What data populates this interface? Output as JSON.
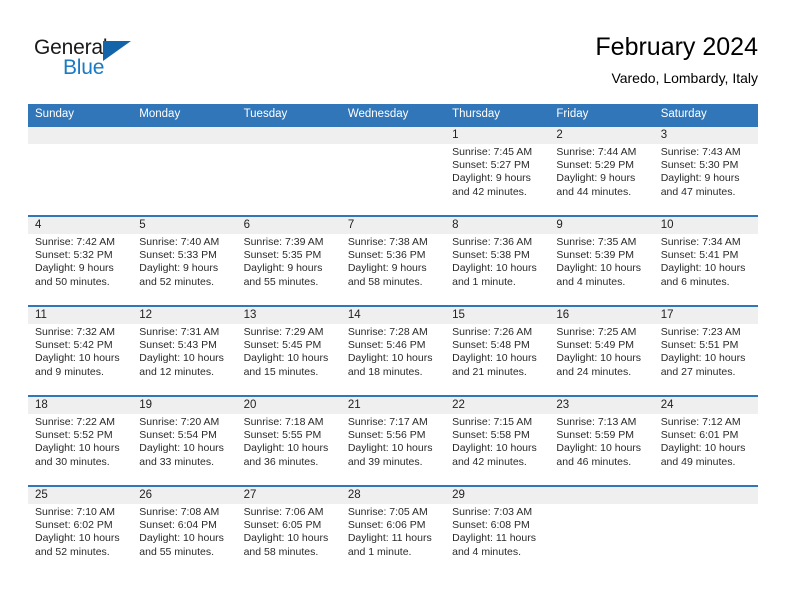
{
  "brand": {
    "name_part1": "General",
    "name_part2": "Blue",
    "accent_color": "#1a7ac4",
    "triangle_color": "#1464aa"
  },
  "header": {
    "title": "February 2024",
    "subtitle": "Varedo, Lombardy, Italy"
  },
  "calendar": {
    "header_bg": "#3176b8",
    "daynum_bg": "#efefef",
    "weekdays": [
      "Sunday",
      "Monday",
      "Tuesday",
      "Wednesday",
      "Thursday",
      "Friday",
      "Saturday"
    ],
    "weeks": [
      [
        {
          "day": "",
          "sunrise": "",
          "sunset": "",
          "daylight": ""
        },
        {
          "day": "",
          "sunrise": "",
          "sunset": "",
          "daylight": ""
        },
        {
          "day": "",
          "sunrise": "",
          "sunset": "",
          "daylight": ""
        },
        {
          "day": "",
          "sunrise": "",
          "sunset": "",
          "daylight": ""
        },
        {
          "day": "1",
          "sunrise": "Sunrise: 7:45 AM",
          "sunset": "Sunset: 5:27 PM",
          "daylight": "Daylight: 9 hours and 42 minutes."
        },
        {
          "day": "2",
          "sunrise": "Sunrise: 7:44 AM",
          "sunset": "Sunset: 5:29 PM",
          "daylight": "Daylight: 9 hours and 44 minutes."
        },
        {
          "day": "3",
          "sunrise": "Sunrise: 7:43 AM",
          "sunset": "Sunset: 5:30 PM",
          "daylight": "Daylight: 9 hours and 47 minutes."
        }
      ],
      [
        {
          "day": "4",
          "sunrise": "Sunrise: 7:42 AM",
          "sunset": "Sunset: 5:32 PM",
          "daylight": "Daylight: 9 hours and 50 minutes."
        },
        {
          "day": "5",
          "sunrise": "Sunrise: 7:40 AM",
          "sunset": "Sunset: 5:33 PM",
          "daylight": "Daylight: 9 hours and 52 minutes."
        },
        {
          "day": "6",
          "sunrise": "Sunrise: 7:39 AM",
          "sunset": "Sunset: 5:35 PM",
          "daylight": "Daylight: 9 hours and 55 minutes."
        },
        {
          "day": "7",
          "sunrise": "Sunrise: 7:38 AM",
          "sunset": "Sunset: 5:36 PM",
          "daylight": "Daylight: 9 hours and 58 minutes."
        },
        {
          "day": "8",
          "sunrise": "Sunrise: 7:36 AM",
          "sunset": "Sunset: 5:38 PM",
          "daylight": "Daylight: 10 hours and 1 minute."
        },
        {
          "day": "9",
          "sunrise": "Sunrise: 7:35 AM",
          "sunset": "Sunset: 5:39 PM",
          "daylight": "Daylight: 10 hours and 4 minutes."
        },
        {
          "day": "10",
          "sunrise": "Sunrise: 7:34 AM",
          "sunset": "Sunset: 5:41 PM",
          "daylight": "Daylight: 10 hours and 6 minutes."
        }
      ],
      [
        {
          "day": "11",
          "sunrise": "Sunrise: 7:32 AM",
          "sunset": "Sunset: 5:42 PM",
          "daylight": "Daylight: 10 hours and 9 minutes."
        },
        {
          "day": "12",
          "sunrise": "Sunrise: 7:31 AM",
          "sunset": "Sunset: 5:43 PM",
          "daylight": "Daylight: 10 hours and 12 minutes."
        },
        {
          "day": "13",
          "sunrise": "Sunrise: 7:29 AM",
          "sunset": "Sunset: 5:45 PM",
          "daylight": "Daylight: 10 hours and 15 minutes."
        },
        {
          "day": "14",
          "sunrise": "Sunrise: 7:28 AM",
          "sunset": "Sunset: 5:46 PM",
          "daylight": "Daylight: 10 hours and 18 minutes."
        },
        {
          "day": "15",
          "sunrise": "Sunrise: 7:26 AM",
          "sunset": "Sunset: 5:48 PM",
          "daylight": "Daylight: 10 hours and 21 minutes."
        },
        {
          "day": "16",
          "sunrise": "Sunrise: 7:25 AM",
          "sunset": "Sunset: 5:49 PM",
          "daylight": "Daylight: 10 hours and 24 minutes."
        },
        {
          "day": "17",
          "sunrise": "Sunrise: 7:23 AM",
          "sunset": "Sunset: 5:51 PM",
          "daylight": "Daylight: 10 hours and 27 minutes."
        }
      ],
      [
        {
          "day": "18",
          "sunrise": "Sunrise: 7:22 AM",
          "sunset": "Sunset: 5:52 PM",
          "daylight": "Daylight: 10 hours and 30 minutes."
        },
        {
          "day": "19",
          "sunrise": "Sunrise: 7:20 AM",
          "sunset": "Sunset: 5:54 PM",
          "daylight": "Daylight: 10 hours and 33 minutes."
        },
        {
          "day": "20",
          "sunrise": "Sunrise: 7:18 AM",
          "sunset": "Sunset: 5:55 PM",
          "daylight": "Daylight: 10 hours and 36 minutes."
        },
        {
          "day": "21",
          "sunrise": "Sunrise: 7:17 AM",
          "sunset": "Sunset: 5:56 PM",
          "daylight": "Daylight: 10 hours and 39 minutes."
        },
        {
          "day": "22",
          "sunrise": "Sunrise: 7:15 AM",
          "sunset": "Sunset: 5:58 PM",
          "daylight": "Daylight: 10 hours and 42 minutes."
        },
        {
          "day": "23",
          "sunrise": "Sunrise: 7:13 AM",
          "sunset": "Sunset: 5:59 PM",
          "daylight": "Daylight: 10 hours and 46 minutes."
        },
        {
          "day": "24",
          "sunrise": "Sunrise: 7:12 AM",
          "sunset": "Sunset: 6:01 PM",
          "daylight": "Daylight: 10 hours and 49 minutes."
        }
      ],
      [
        {
          "day": "25",
          "sunrise": "Sunrise: 7:10 AM",
          "sunset": "Sunset: 6:02 PM",
          "daylight": "Daylight: 10 hours and 52 minutes."
        },
        {
          "day": "26",
          "sunrise": "Sunrise: 7:08 AM",
          "sunset": "Sunset: 6:04 PM",
          "daylight": "Daylight: 10 hours and 55 minutes."
        },
        {
          "day": "27",
          "sunrise": "Sunrise: 7:06 AM",
          "sunset": "Sunset: 6:05 PM",
          "daylight": "Daylight: 10 hours and 58 minutes."
        },
        {
          "day": "28",
          "sunrise": "Sunrise: 7:05 AM",
          "sunset": "Sunset: 6:06 PM",
          "daylight": "Daylight: 11 hours and 1 minute."
        },
        {
          "day": "29",
          "sunrise": "Sunrise: 7:03 AM",
          "sunset": "Sunset: 6:08 PM",
          "daylight": "Daylight: 11 hours and 4 minutes."
        },
        {
          "day": "",
          "sunrise": "",
          "sunset": "",
          "daylight": ""
        },
        {
          "day": "",
          "sunrise": "",
          "sunset": "",
          "daylight": ""
        }
      ]
    ]
  }
}
